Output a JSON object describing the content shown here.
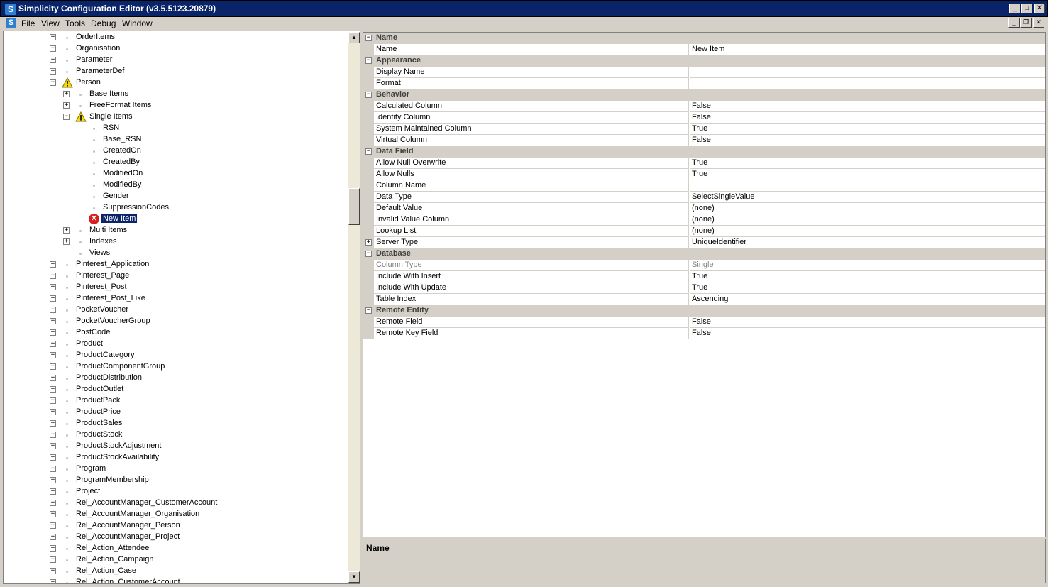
{
  "window": {
    "title": "Simplicity Configuration Editor (v3.5.5123.20879)",
    "app_icon_letter": "S"
  },
  "menu": {
    "items": [
      "File",
      "View",
      "Tools",
      "Debug",
      "Window"
    ]
  },
  "tree": {
    "rows": [
      {
        "label": "OrderItems",
        "level": 0,
        "expander": "+",
        "icon": "dot"
      },
      {
        "label": "Organisation",
        "level": 0,
        "expander": "+",
        "icon": "dot"
      },
      {
        "label": "Parameter",
        "level": 0,
        "expander": "+",
        "icon": "dot"
      },
      {
        "label": "ParameterDef",
        "level": 0,
        "expander": "+",
        "icon": "dot"
      },
      {
        "label": "Person",
        "level": 0,
        "expander": "−",
        "icon": "warning"
      },
      {
        "label": "Base Items",
        "level": 1,
        "expander": "+",
        "icon": "dot"
      },
      {
        "label": "FreeFormat Items",
        "level": 1,
        "expander": "+",
        "icon": "dot"
      },
      {
        "label": "Single Items",
        "level": 1,
        "expander": "−",
        "icon": "warning"
      },
      {
        "label": "RSN",
        "level": 2,
        "expander": "",
        "icon": "dot"
      },
      {
        "label": "Base_RSN",
        "level": 2,
        "expander": "",
        "icon": "dot"
      },
      {
        "label": "CreatedOn",
        "level": 2,
        "expander": "",
        "icon": "dot"
      },
      {
        "label": "CreatedBy",
        "level": 2,
        "expander": "",
        "icon": "dot"
      },
      {
        "label": "ModifiedOn",
        "level": 2,
        "expander": "",
        "icon": "dot"
      },
      {
        "label": "ModifiedBy",
        "level": 2,
        "expander": "",
        "icon": "dot"
      },
      {
        "label": "Gender",
        "level": 2,
        "expander": "",
        "icon": "dot"
      },
      {
        "label": "SuppressionCodes",
        "level": 2,
        "expander": "",
        "icon": "dot"
      },
      {
        "label": "New Item",
        "level": 2,
        "expander": "",
        "icon": "error",
        "selected": true
      },
      {
        "label": "Multi Items",
        "level": 1,
        "expander": "+",
        "icon": "dot"
      },
      {
        "label": "Indexes",
        "level": 1,
        "expander": "+",
        "icon": "dot"
      },
      {
        "label": "Views",
        "level": 1,
        "expander": "",
        "icon": "dot"
      },
      {
        "label": "Pinterest_Application",
        "level": 0,
        "expander": "+",
        "icon": "dot"
      },
      {
        "label": "Pinterest_Page",
        "level": 0,
        "expander": "+",
        "icon": "dot"
      },
      {
        "label": "Pinterest_Post",
        "level": 0,
        "expander": "+",
        "icon": "dot"
      },
      {
        "label": "Pinterest_Post_Like",
        "level": 0,
        "expander": "+",
        "icon": "dot"
      },
      {
        "label": "PocketVoucher",
        "level": 0,
        "expander": "+",
        "icon": "dot"
      },
      {
        "label": "PocketVoucherGroup",
        "level": 0,
        "expander": "+",
        "icon": "dot"
      },
      {
        "label": "PostCode",
        "level": 0,
        "expander": "+",
        "icon": "dot"
      },
      {
        "label": "Product",
        "level": 0,
        "expander": "+",
        "icon": "dot"
      },
      {
        "label": "ProductCategory",
        "level": 0,
        "expander": "+",
        "icon": "dot"
      },
      {
        "label": "ProductComponentGroup",
        "level": 0,
        "expander": "+",
        "icon": "dot"
      },
      {
        "label": "ProductDistribution",
        "level": 0,
        "expander": "+",
        "icon": "dot"
      },
      {
        "label": "ProductOutlet",
        "level": 0,
        "expander": "+",
        "icon": "dot"
      },
      {
        "label": "ProductPack",
        "level": 0,
        "expander": "+",
        "icon": "dot"
      },
      {
        "label": "ProductPrice",
        "level": 0,
        "expander": "+",
        "icon": "dot"
      },
      {
        "label": "ProductSales",
        "level": 0,
        "expander": "+",
        "icon": "dot"
      },
      {
        "label": "ProductStock",
        "level": 0,
        "expander": "+",
        "icon": "dot"
      },
      {
        "label": "ProductStockAdjustment",
        "level": 0,
        "expander": "+",
        "icon": "dot"
      },
      {
        "label": "ProductStockAvailability",
        "level": 0,
        "expander": "+",
        "icon": "dot"
      },
      {
        "label": "Program",
        "level": 0,
        "expander": "+",
        "icon": "dot"
      },
      {
        "label": "ProgramMembership",
        "level": 0,
        "expander": "+",
        "icon": "dot"
      },
      {
        "label": "Project",
        "level": 0,
        "expander": "+",
        "icon": "dot"
      },
      {
        "label": "Rel_AccountManager_CustomerAccount",
        "level": 0,
        "expander": "+",
        "icon": "dot"
      },
      {
        "label": "Rel_AccountManager_Organisation",
        "level": 0,
        "expander": "+",
        "icon": "dot"
      },
      {
        "label": "Rel_AccountManager_Person",
        "level": 0,
        "expander": "+",
        "icon": "dot"
      },
      {
        "label": "Rel_AccountManager_Project",
        "level": 0,
        "expander": "+",
        "icon": "dot"
      },
      {
        "label": "Rel_Action_Attendee",
        "level": 0,
        "expander": "+",
        "icon": "dot"
      },
      {
        "label": "Rel_Action_Campaign",
        "level": 0,
        "expander": "+",
        "icon": "dot"
      },
      {
        "label": "Rel_Action_Case",
        "level": 0,
        "expander": "+",
        "icon": "dot"
      },
      {
        "label": "Rel_Action_CustomerAccount",
        "level": 0,
        "expander": "+",
        "icon": "dot"
      }
    ]
  },
  "property_grid": {
    "rows": [
      {
        "type": "category",
        "label": "Name"
      },
      {
        "type": "prop",
        "name": "Name",
        "value": "New Item"
      },
      {
        "type": "category",
        "label": "Appearance"
      },
      {
        "type": "prop",
        "name": "Display Name",
        "value": ""
      },
      {
        "type": "prop",
        "name": "Format",
        "value": ""
      },
      {
        "type": "category",
        "label": "Behavior"
      },
      {
        "type": "prop",
        "name": "Calculated Column",
        "value": "False"
      },
      {
        "type": "prop",
        "name": "Identity Column",
        "value": "False"
      },
      {
        "type": "prop",
        "name": "System Maintained Column",
        "value": "True"
      },
      {
        "type": "prop",
        "name": "Virtual Column",
        "value": "False"
      },
      {
        "type": "category",
        "label": "Data Field"
      },
      {
        "type": "prop",
        "name": "Allow Null Overwrite",
        "value": "True"
      },
      {
        "type": "prop",
        "name": "Allow Nulls",
        "value": "True"
      },
      {
        "type": "prop",
        "name": "Column Name",
        "value": ""
      },
      {
        "type": "prop",
        "name": "Data Type",
        "value": "SelectSingleValue"
      },
      {
        "type": "prop",
        "name": "Default Value",
        "value": "(none)"
      },
      {
        "type": "prop",
        "name": "Invalid Value Column",
        "value": "(none)"
      },
      {
        "type": "prop",
        "name": "Lookup List",
        "value": "(none)"
      },
      {
        "type": "prop",
        "name": "Server Type",
        "value": "UniqueIdentifier",
        "expandable": true
      },
      {
        "type": "category",
        "label": "Database"
      },
      {
        "type": "prop",
        "name": "Column Type",
        "value": "Single",
        "disabled": true
      },
      {
        "type": "prop",
        "name": "Include With Insert",
        "value": "True"
      },
      {
        "type": "prop",
        "name": "Include With Update",
        "value": "True"
      },
      {
        "type": "prop",
        "name": "Table Index",
        "value": "Ascending"
      },
      {
        "type": "category",
        "label": "Remote Entity"
      },
      {
        "type": "prop",
        "name": "Remote Field",
        "value": "False"
      },
      {
        "type": "prop",
        "name": "Remote Key Field",
        "value": "False"
      }
    ]
  },
  "description": {
    "title": "Name"
  }
}
